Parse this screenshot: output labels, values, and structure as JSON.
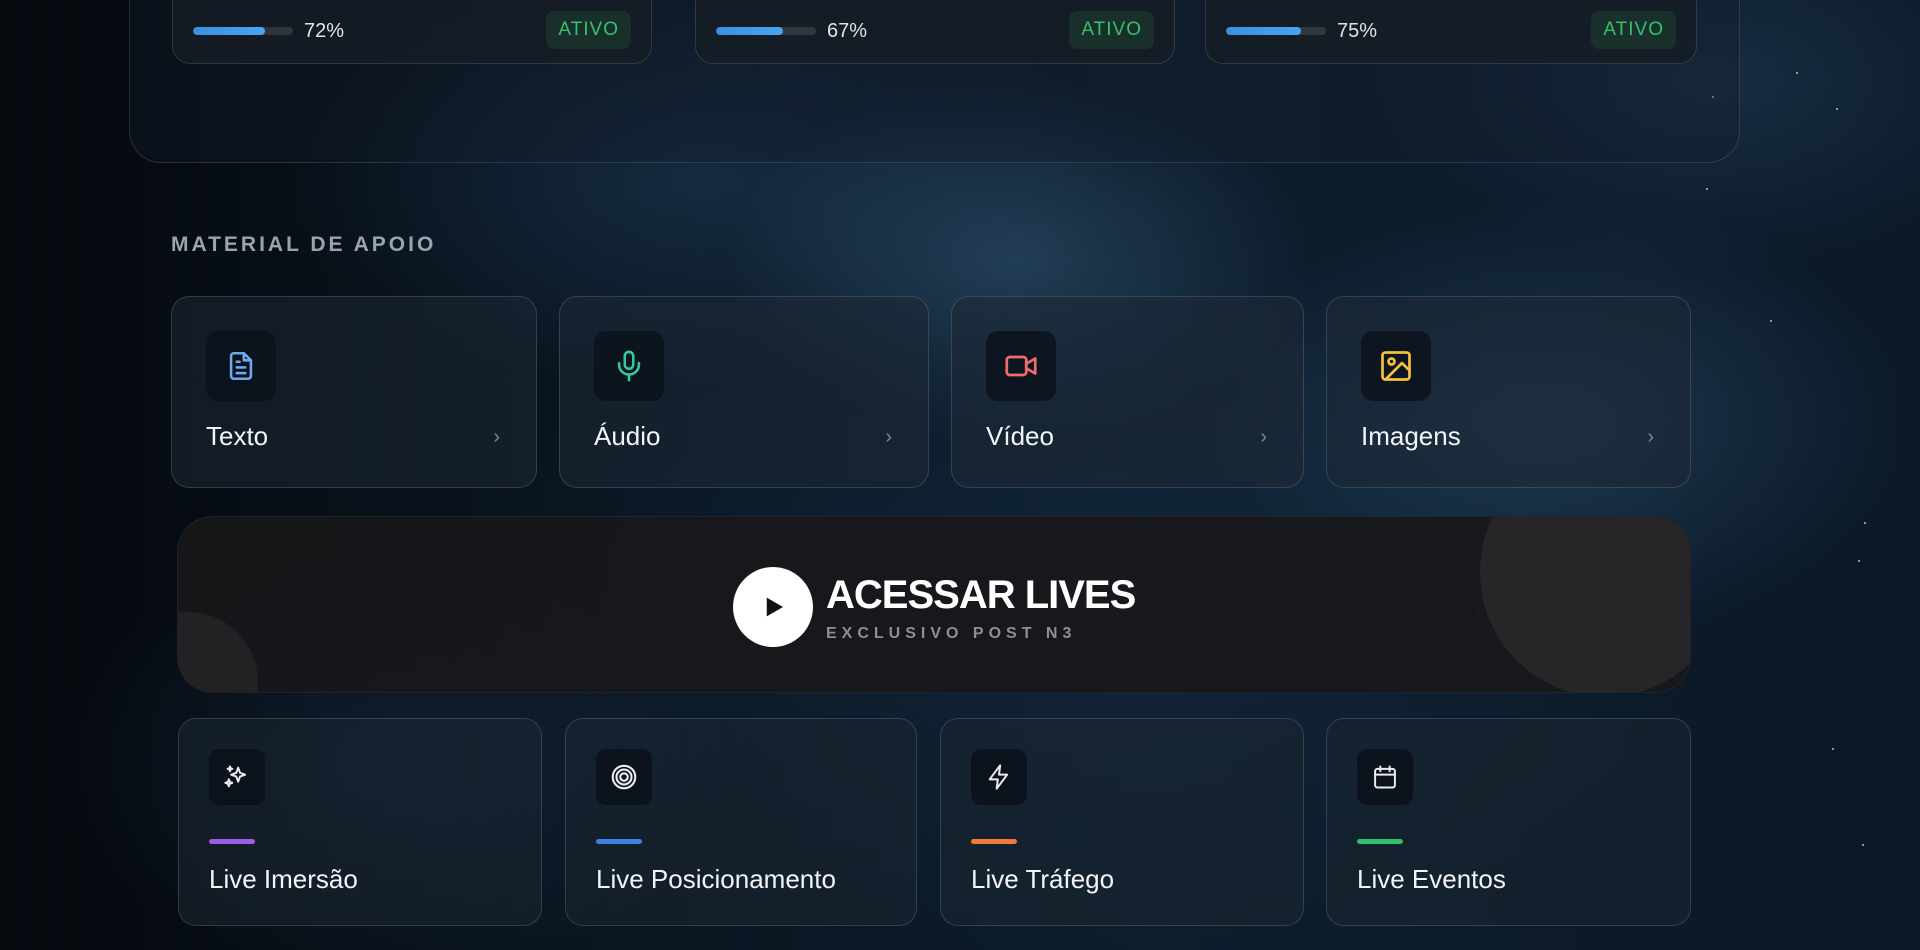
{
  "courses": [
    {
      "progress_text": "72%",
      "progress": 0.72,
      "status": "ATIVO"
    },
    {
      "progress_text": "67%",
      "progress": 0.67,
      "status": "ATIVO"
    },
    {
      "progress_text": "75%",
      "progress": 0.75,
      "status": "ATIVO"
    }
  ],
  "support": {
    "title": "MATERIAL DE APOIO",
    "items": [
      {
        "label": "Texto",
        "icon": "document-icon",
        "color": "#6ea8f0"
      },
      {
        "label": "Áudio",
        "icon": "microphone-icon",
        "color": "#36c99a"
      },
      {
        "label": "Vídeo",
        "icon": "video-camera-icon",
        "color": "#f06a72"
      },
      {
        "label": "Imagens",
        "icon": "image-icon",
        "color": "#f3c13a"
      }
    ]
  },
  "lives_banner": {
    "title": "ACESSAR LIVES",
    "subtitle": "EXCLUSIVO POST N3"
  },
  "lives": [
    {
      "label": "Live Imersão",
      "icon": "sparkles-icon",
      "accent": "#9b5de5"
    },
    {
      "label": "Live Posicionamento",
      "icon": "target-icon",
      "accent": "#3b82e6"
    },
    {
      "label": "Live Tráfego",
      "icon": "lightning-icon",
      "accent": "#f07a3a"
    },
    {
      "label": "Live Eventos",
      "icon": "calendar-icon",
      "accent": "#2fbf6a"
    }
  ]
}
